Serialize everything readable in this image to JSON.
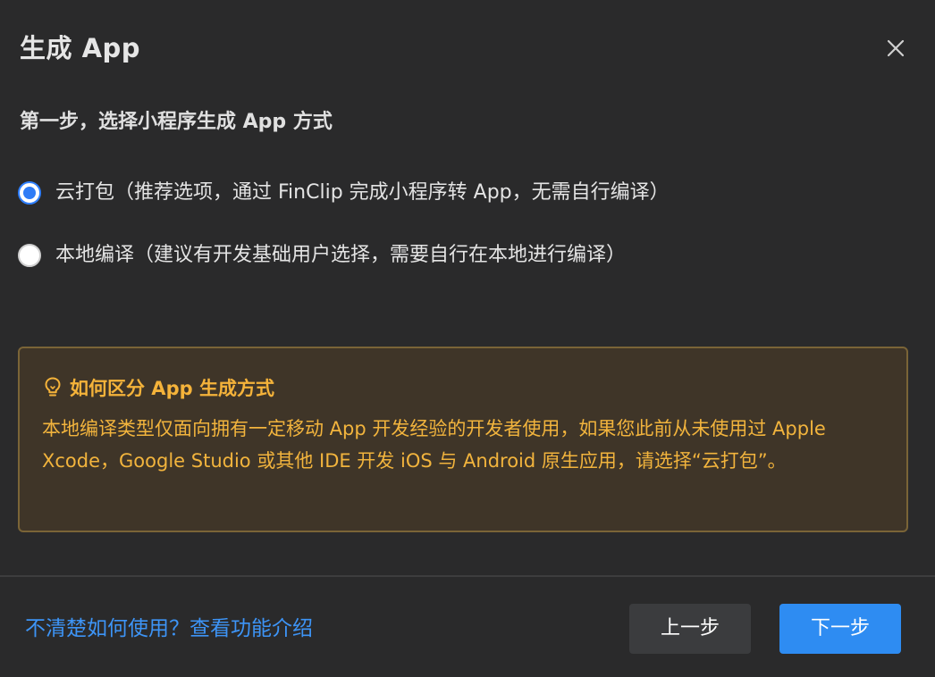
{
  "dialog": {
    "title": "生成 App",
    "close_icon": "close-icon"
  },
  "step": {
    "title": "第一步，选择小程序生成 App 方式"
  },
  "options": [
    {
      "label": "云打包（推荐选项，通过 FinClip 完成小程序转 App，无需自行编译）",
      "selected": true
    },
    {
      "label": "本地编译（建议有开发基础用户选择，需要自行在本地进行编译）",
      "selected": false
    }
  ],
  "tip": {
    "icon": "lightbulb-icon",
    "title": "如何区分 App 生成方式",
    "body": "本地编译类型仅面向拥有一定移动 App 开发经验的开发者使用，如果您此前从未使用过 Apple Xcode，Google Studio 或其他 IDE 开发 iOS 与 Android 原生应用，请选择“云打包”。",
    "text_color": "#f2b43d",
    "background": "#3f3528",
    "border_color": "#7a6437"
  },
  "footer": {
    "help_link": "不清楚如何使用？查看功能介绍",
    "prev_label": "上一步",
    "next_label": "下一步",
    "accent": "#2e8cf2"
  }
}
